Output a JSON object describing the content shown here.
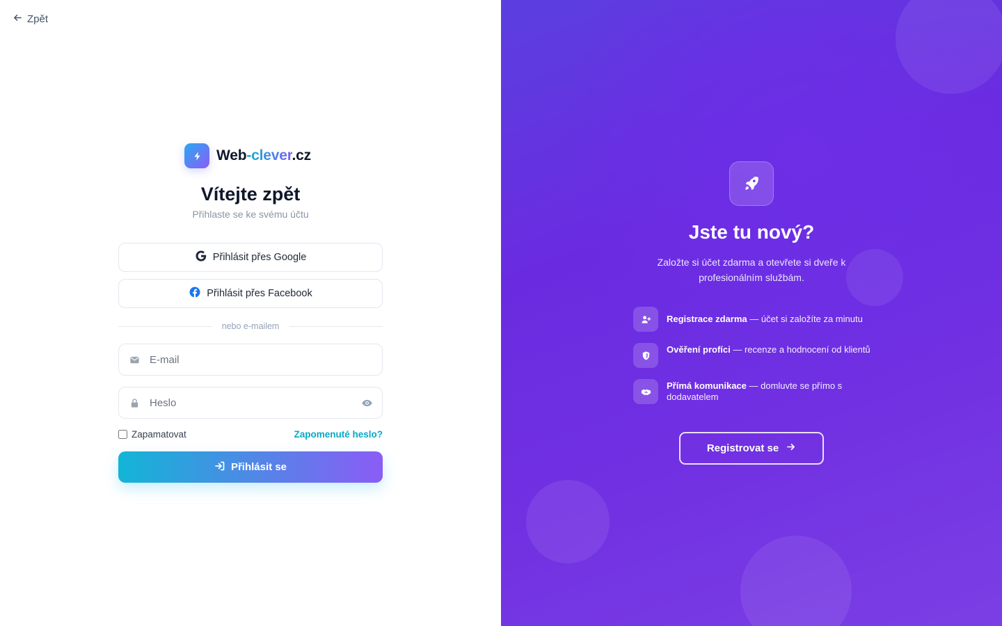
{
  "back": {
    "label": "Zpět",
    "icon": "arrow-left-icon"
  },
  "logo": {
    "part1": "Web",
    "part2": "-clever",
    "part3": ".cz",
    "icon": "lightning-icon"
  },
  "login": {
    "title": "Vítejte zpět",
    "subtitle": "Přihlaste se ke svému účtu",
    "google_label": "Přihlásit přes Google",
    "facebook_label": "Přihlásit přes Facebook",
    "divider": "nebo e-mailem",
    "email_placeholder": "E-mail",
    "email_value": "",
    "password_placeholder": "Heslo",
    "password_value": "",
    "remember_label": "Zapamatovat",
    "remember_checked": false,
    "forgot_label": "Zapomenuté heslo?",
    "submit_label": "Přihlásit se"
  },
  "promo": {
    "icon": "rocket-icon",
    "title": "Jste tu nový?",
    "subtitle": "Založte si účet zdarma a otevřete si dveře k profesionálním službám.",
    "features": [
      {
        "icon": "user-plus-icon",
        "bold": "Registrace zdarma",
        "text": " — účet si založíte za minutu"
      },
      {
        "icon": "shield-icon",
        "bold": "Ověření profíci",
        "text": " — recenze a hodnocení od klientů"
      },
      {
        "icon": "handshake-icon",
        "bold": "Přímá komunikace",
        "text": " — domluvte se přímo s dodavatelem"
      }
    ],
    "register_label": "Registrovat se"
  },
  "colors": {
    "accent_cyan": "#06b6d4",
    "accent_violet": "#8b5cf6",
    "panel_purple": "#6d2ee6",
    "link": "#06a9c6"
  }
}
